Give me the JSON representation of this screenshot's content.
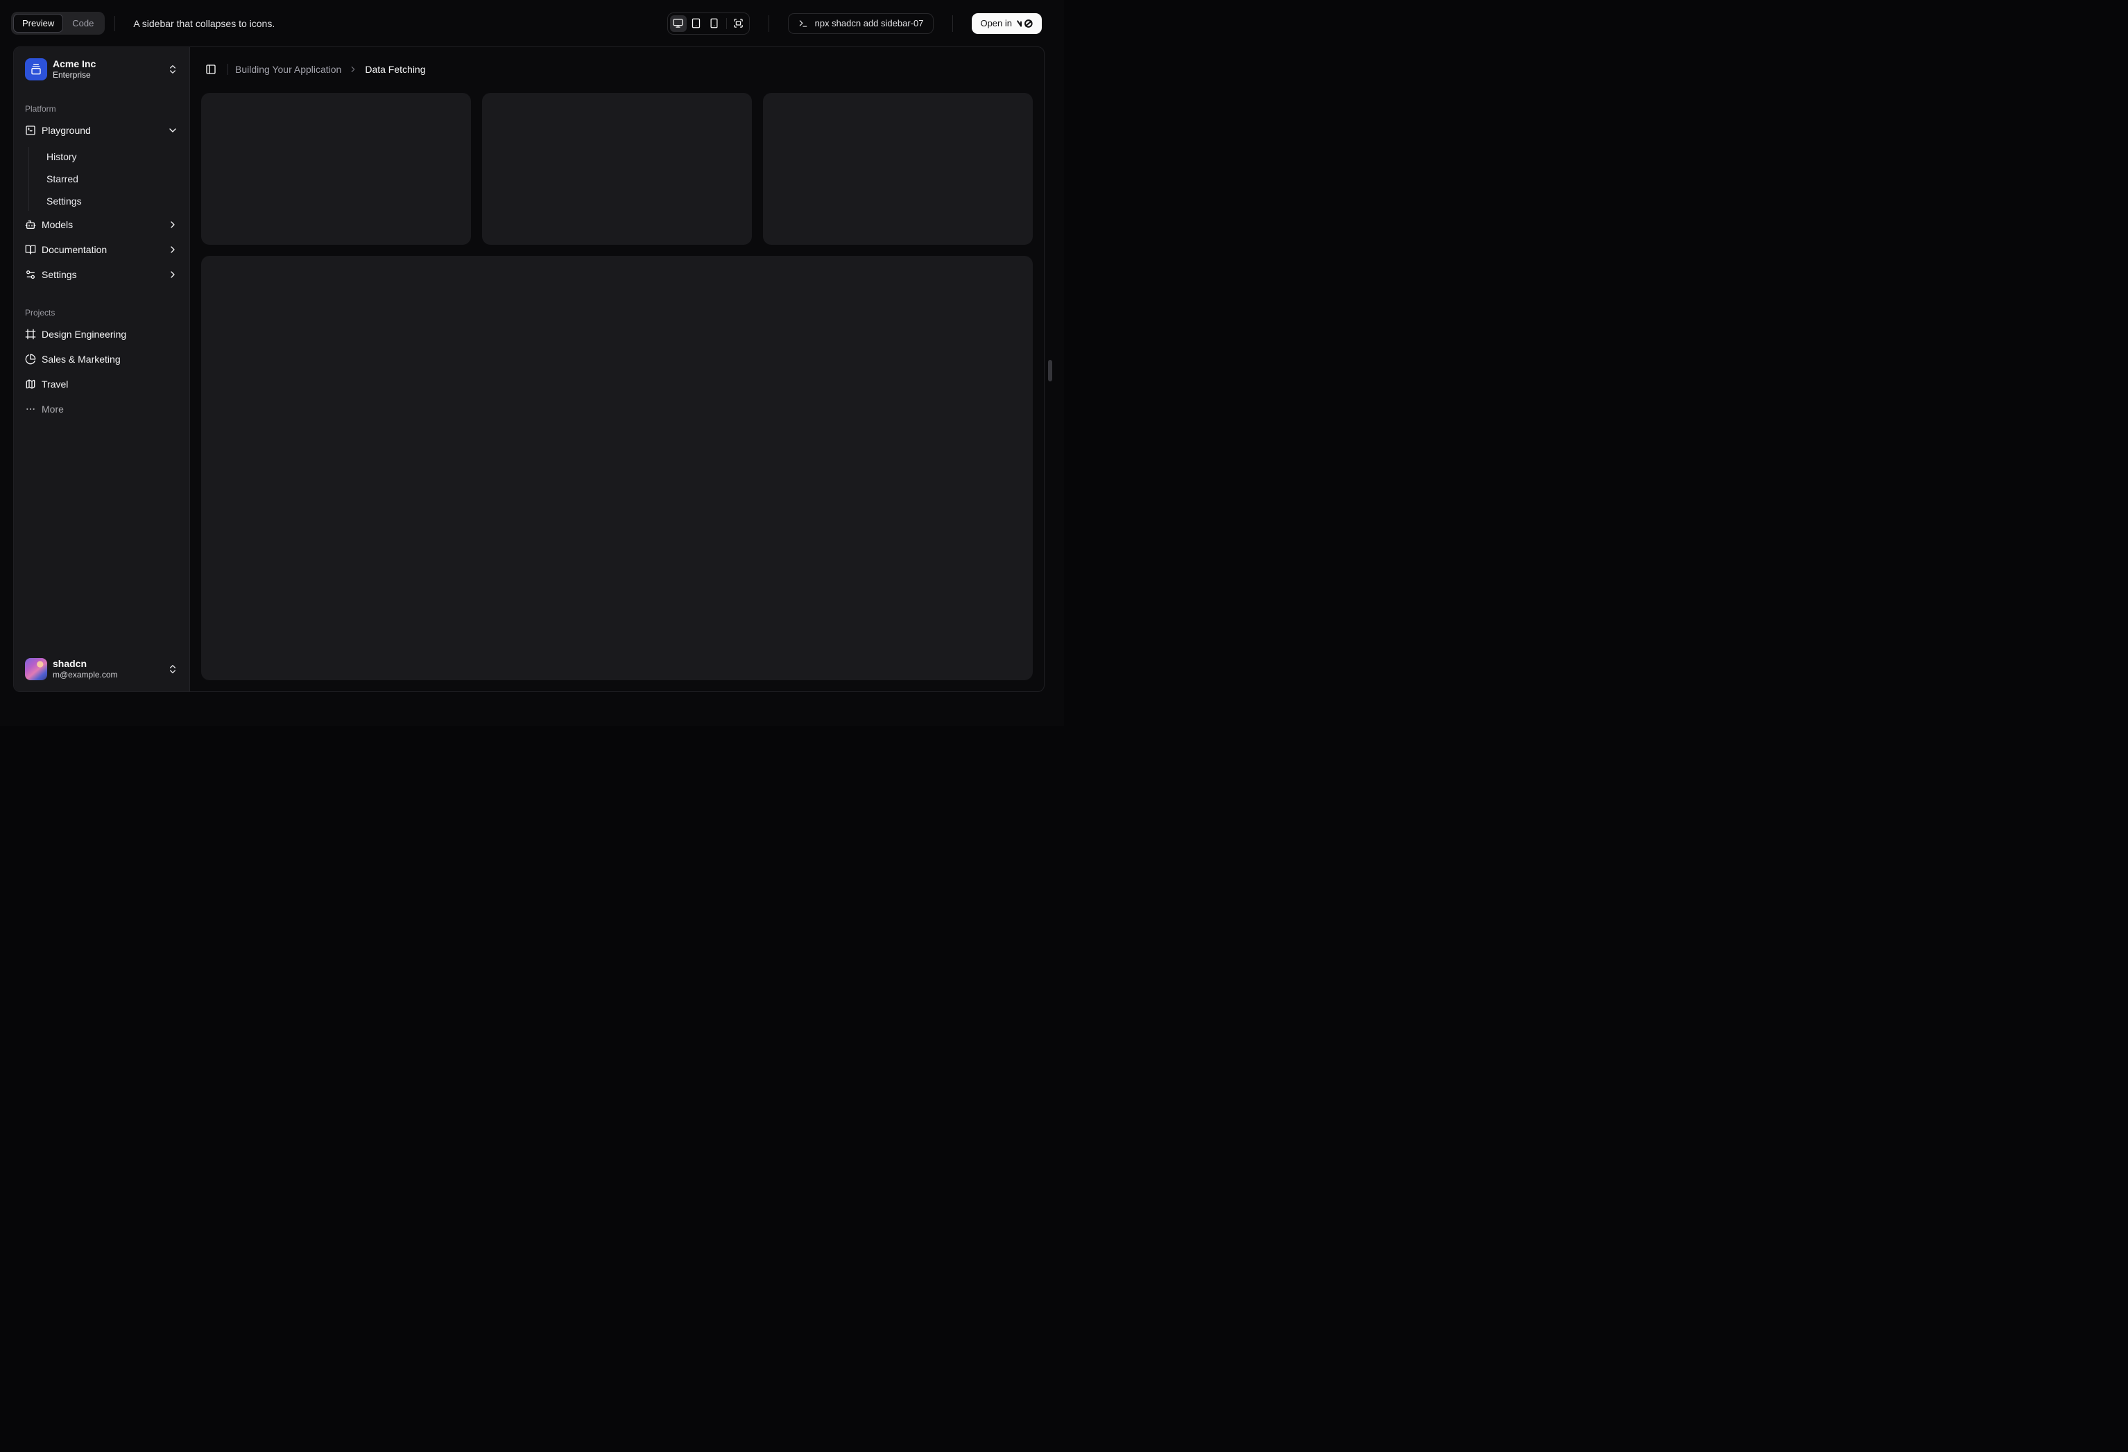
{
  "header": {
    "view_tabs": [
      {
        "label": "Preview"
      },
      {
        "label": "Code"
      }
    ],
    "active_tab": "Preview",
    "description": "A sidebar that collapses to icons.",
    "command": "npx shadcn add sidebar-07",
    "open_in_label": "Open in",
    "v0_logo": "v0"
  },
  "breadcrumb": {
    "section": "Building Your Application",
    "page": "Data Fetching"
  },
  "sidebar": {
    "org": {
      "name": "Acme Inc",
      "plan": "Enterprise"
    },
    "groups": [
      {
        "label": "Platform",
        "items": [
          {
            "label": "Playground",
            "icon": "square-terminal-icon",
            "expanded": true,
            "children": [
              {
                "label": "History"
              },
              {
                "label": "Starred"
              },
              {
                "label": "Settings"
              }
            ]
          },
          {
            "label": "Models",
            "icon": "bot-icon"
          },
          {
            "label": "Documentation",
            "icon": "book-open-icon"
          },
          {
            "label": "Settings",
            "icon": "sliders-icon"
          }
        ]
      },
      {
        "label": "Projects",
        "items": [
          {
            "label": "Design Engineering",
            "icon": "frame-icon"
          },
          {
            "label": "Sales & Marketing",
            "icon": "pie-chart-icon"
          },
          {
            "label": "Travel",
            "icon": "map-icon"
          },
          {
            "label": "More",
            "icon": "ellipsis-icon"
          }
        ]
      }
    ],
    "user": {
      "name": "shadcn",
      "email": "m@example.com"
    }
  },
  "colors": {
    "accent_blue": "#2c52d9",
    "sidebar_bg": "#18181b",
    "canvas_bg": "#0a0a0c",
    "card_bg": "#1a1a1d",
    "text_primary": "#fafafa",
    "text_muted": "#a1a1aa"
  }
}
